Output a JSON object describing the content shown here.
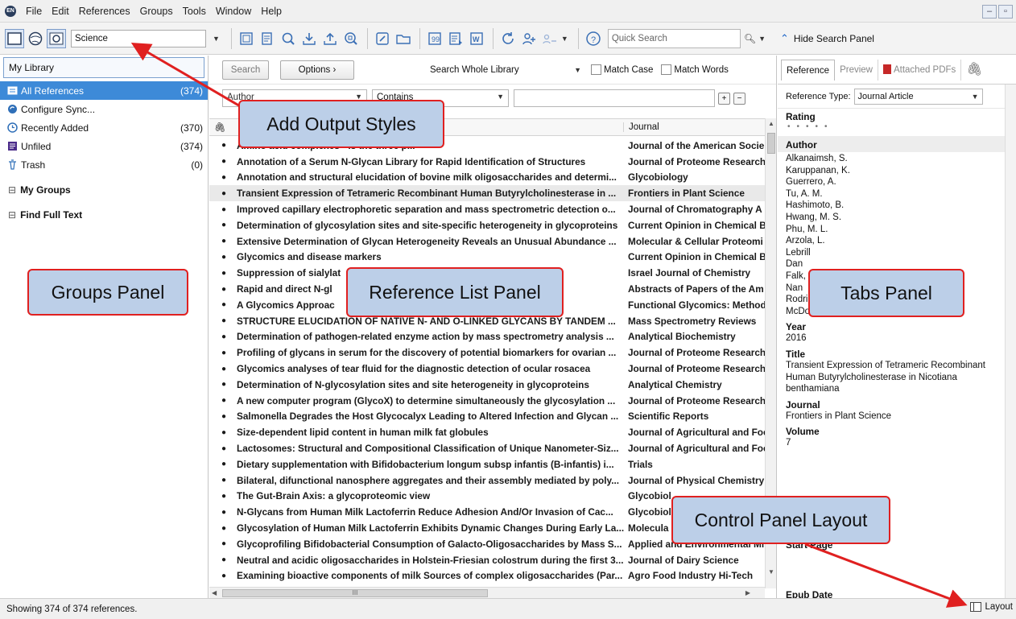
{
  "menubar": {
    "items": [
      "File",
      "Edit",
      "References",
      "Groups",
      "Tools",
      "Window",
      "Help"
    ]
  },
  "toolbar": {
    "output_style": "Science",
    "quick_search_placeholder": "Quick Search",
    "hide_search_label": "Hide Search Panel",
    "icons": [
      "local-library-icon",
      "online-search-icon",
      "integrated-library-icon",
      "new-reference-icon",
      "import-icon",
      "export-icon",
      "find-full-text-icon",
      "open-link-icon",
      "open-file-icon",
      "insert-citation-icon",
      "format-bibliography-icon",
      "return-to-word-icon",
      "sync-icon",
      "share-library-icon",
      "share-group-icon",
      "help-icon"
    ]
  },
  "groups": {
    "library_title": "My Library",
    "items": [
      {
        "label": "All References",
        "count": "(374)",
        "icon": "references-icon"
      },
      {
        "label": "Configure Sync...",
        "count": "",
        "icon": "sync-icon"
      },
      {
        "label": "Recently Added",
        "count": "(370)",
        "icon": "clock-icon"
      },
      {
        "label": "Unfiled",
        "count": "(374)",
        "icon": "unfiled-icon"
      },
      {
        "label": "Trash",
        "count": "(0)",
        "icon": "trash-icon"
      }
    ],
    "sections": [
      "My Groups",
      "Find Full Text"
    ]
  },
  "search": {
    "search_button": "Search",
    "options_button": "Options ›",
    "scope": "Search Whole Library",
    "match_case": "Match Case",
    "match_words": "Match Words",
    "field": "Author",
    "operator": "Contains"
  },
  "reference_list": {
    "journal_header": "Journal",
    "rows": [
      {
        "title": "Amino acid complexes - Is the three p...",
        "journal": "Journal of the American Socie"
      },
      {
        "title": "Annotation of a Serum N-Glycan Library for Rapid Identification of Structures",
        "journal": "Journal of Proteome Research"
      },
      {
        "title": "Annotation and structural elucidation of bovine milk oligosaccharides and determi...",
        "journal": "Glycobiology"
      },
      {
        "title": "Transient Expression of Tetrameric Recombinant Human Butyrylcholinesterase in ...",
        "journal": "Frontiers in Plant Science"
      },
      {
        "title": "Improved capillary electrophoretic separation and mass spectrometric detection o...",
        "journal": "Journal of Chromatography A"
      },
      {
        "title": "Determination of glycosylation sites and site-specific heterogeneity in glycoproteins",
        "journal": "Current Opinion in Chemical B"
      },
      {
        "title": "Extensive Determination of Glycan Heterogeneity Reveals an Unusual Abundance ...",
        "journal": "Molecular & Cellular Proteomi"
      },
      {
        "title": "Glycomics and disease markers",
        "journal": "Current Opinion in Chemical B"
      },
      {
        "title": "Suppression of sialylat",
        "journal": "Israel Journal of Chemistry"
      },
      {
        "title": "Rapid and direct N-gl",
        "journal": "Abstracts of Papers of the Am"
      },
      {
        "title": "A Glycomics Approac",
        "journal": "Functional Glycomics: Method"
      },
      {
        "title": "STRUCTURE ELUCIDATION OF NATIVE N- AND O-LINKED GLYCANS BY TANDEM ...",
        "journal": "Mass Spectrometry Reviews"
      },
      {
        "title": "Determination of pathogen-related enzyme action by mass spectrometry analysis ...",
        "journal": "Analytical Biochemistry"
      },
      {
        "title": "Profiling of glycans in serum for the discovery of potential biomarkers for ovarian ...",
        "journal": "Journal of Proteome Research"
      },
      {
        "title": "Glycomics analyses of tear fluid for the diagnostic detection of ocular rosacea",
        "journal": "Journal of Proteome Research"
      },
      {
        "title": "Determination of N-glycosylation sites and site heterogeneity in glycoproteins",
        "journal": "Analytical Chemistry"
      },
      {
        "title": "A new computer program (GlycoX) to determine simultaneously the glycosylation ...",
        "journal": "Journal of Proteome Research"
      },
      {
        "title": "Salmonella Degrades the Host Glycocalyx Leading to Altered Infection and Glycan ...",
        "journal": "Scientific Reports"
      },
      {
        "title": "Size-dependent lipid content in human milk fat globules",
        "journal": "Journal of Agricultural and Foc"
      },
      {
        "title": "Lactosomes: Structural and Compositional Classification of Unique Nanometer-Siz...",
        "journal": "Journal of Agricultural and Foc"
      },
      {
        "title": "Dietary supplementation with Bifidobacterium longum subsp infantis (B-infantis) i...",
        "journal": "Trials"
      },
      {
        "title": "Bilateral, difunctional nanosphere aggregates and their assembly mediated by poly...",
        "journal": "Journal of Physical Chemistry /"
      },
      {
        "title": "The Gut-Brain Axis: a glycoproteomic view",
        "journal": "Glycobiol"
      },
      {
        "title": "N-Glycans from Human Milk Lactoferrin Reduce Adhesion And/Or Invasion of Cac...",
        "journal": "Glycobiol"
      },
      {
        "title": "Glycosylation of Human Milk Lactoferrin Exhibits Dynamic Changes During Early La...",
        "journal": "Molecula"
      },
      {
        "title": "Glycoprofiling Bifidobacterial Consumption of Galacto-Oligosaccharides by Mass S...",
        "journal": "Applied and Environmental Mi"
      },
      {
        "title": "Neutral and acidic oligosaccharides in Holstein-Friesian colostrum during the first 3...",
        "journal": "Journal of Dairy Science"
      },
      {
        "title": "Examining bioactive components of milk Sources of complex oligosaccharides (Par...",
        "journal": "Agro Food Industry Hi-Tech"
      }
    ]
  },
  "tabs_panel": {
    "tabs": [
      "Reference",
      "Preview",
      "Attached PDFs"
    ],
    "ref_type_label": "Reference Type:",
    "ref_type_value": "Journal Article",
    "rating_label": "Rating",
    "author_label": "Author",
    "authors": [
      "Alkanaimsh, S.",
      "Karuppanan, K.",
      "Guerrero, A.",
      "Tu, A. M.",
      "Hashimoto, B.",
      "Hwang, M. S.",
      "Phu, M. L.",
      "Arzola, L.",
      "Lebrill",
      "Dan",
      "Falk,",
      "Nan",
      "Rodriguez, R. L.",
      "McDonald, K. A."
    ],
    "year_label": "Year",
    "year_value": "2016",
    "title_label": "Title",
    "title_value": "Transient Expression of Tetrameric Recombinant Human Butyrylcholinesterase in Nicotiana benthamiana",
    "journal_label": "Journal",
    "journal_value": "Frontiers in Plant Science",
    "volume_label": "Volume",
    "volume_value": "7",
    "start_page_label": "Start Page",
    "epub_date_label": "Epub Date"
  },
  "status": {
    "text": "Showing 374 of 374 references.",
    "layout_label": "Layout"
  },
  "callouts": {
    "add_output_styles": "Add Output Styles",
    "groups_panel": "Groups Panel",
    "reference_list_panel": "Reference List Panel",
    "tabs_panel": "Tabs Panel",
    "control_panel_layout": "Control Panel Layout"
  },
  "colors": {
    "selection_blue": "#3d8ad8",
    "callout_fill": "#bccfe8",
    "callout_border": "#e02020",
    "arrow": "#e02020"
  }
}
